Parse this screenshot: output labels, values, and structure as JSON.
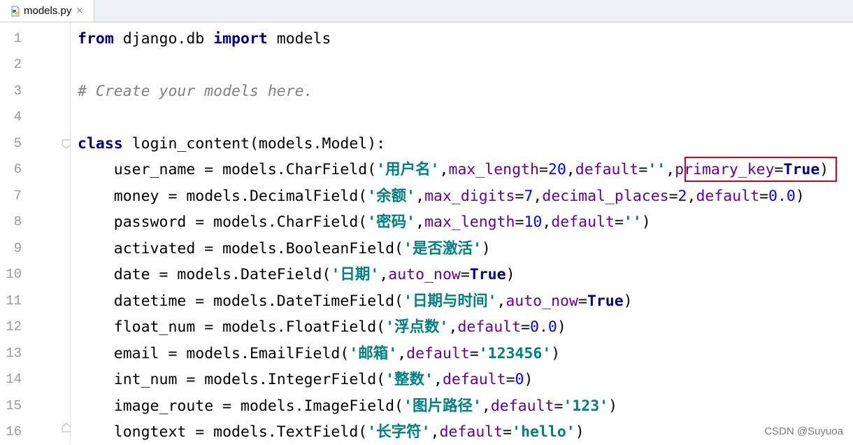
{
  "tab": {
    "filename": "models.py",
    "close_icon": "×"
  },
  "gutter": {
    "numbers": [
      "1",
      "2",
      "3",
      "4",
      "5",
      "6",
      "7",
      "8",
      "9",
      "10",
      "11",
      "12",
      "13",
      "14",
      "15",
      "16"
    ]
  },
  "code": {
    "l1": {
      "k1": "from",
      "t1": " django.db ",
      "k2": "import",
      "t2": " models"
    },
    "l3": {
      "c": "# Create your models here."
    },
    "l5": {
      "k": "class",
      "t": " login_content(models.Model):"
    },
    "l6": {
      "t1": "    user_name = models.CharField(",
      "s1": "'用户名'",
      "t2": ",",
      "a1": "max_length",
      "t3": "=",
      "n1": "20",
      "t4": ",",
      "a2": "default",
      "t5": "=",
      "s2": "''",
      "t6": ",",
      "a3": "primary_key",
      "t7": "=",
      "k1": "True",
      "t8": ")"
    },
    "l7": {
      "t1": "    money = models.DecimalField(",
      "s1": "'余额'",
      "t2": ",",
      "a1": "max_digits",
      "t3": "=",
      "n1": "7",
      "t4": ",",
      "a2": "decimal_places",
      "t5": "=",
      "n2": "2",
      "t6": ",",
      "a3": "default",
      "t7": "=",
      "n3": "0.0",
      "t8": ")"
    },
    "l8": {
      "t1": "    password = models.CharField(",
      "s1": "'密码'",
      "t2": ",",
      "a1": "max_length",
      "t3": "=",
      "n1": "10",
      "t4": ",",
      "a2": "default",
      "t5": "=",
      "s2": "''",
      "t6": ")"
    },
    "l9": {
      "t1": "    activated = models.BooleanField(",
      "s1": "'是否激活'",
      "t2": ")"
    },
    "l10": {
      "t1": "    date = models.DateField(",
      "s1": "'日期'",
      "t2": ",",
      "a1": "auto_now",
      "t3": "=",
      "k1": "True",
      "t4": ")"
    },
    "l11": {
      "t1": "    datetime = models.DateTimeField(",
      "s1": "'日期与时间'",
      "t2": ",",
      "a1": "auto_now",
      "t3": "=",
      "k1": "True",
      "t4": ")"
    },
    "l12": {
      "t1": "    float_num = models.FloatField(",
      "s1": "'浮点数'",
      "t2": ",",
      "a1": "default",
      "t3": "=",
      "n1": "0.0",
      "t4": ")"
    },
    "l13": {
      "t1": "    email = models.EmailField(",
      "s1": "'邮箱'",
      "t2": ",",
      "a1": "default",
      "t3": "=",
      "s2": "'123456'",
      "t4": ")"
    },
    "l14": {
      "t1": "    int_num = models.IntegerField(",
      "s1": "'整数'",
      "t2": ",",
      "a1": "default",
      "t3": "=",
      "n1": "0",
      "t4": ")"
    },
    "l15": {
      "t1": "    image_route = models.ImageField(",
      "s1": "'图片路径'",
      "t2": ",",
      "a1": "default",
      "t3": "=",
      "s2": "'123'",
      "t4": ")"
    },
    "l16": {
      "t1": "    longtext = models.TextField(",
      "s1": "'长字符'",
      "t2": ",",
      "a1": "default",
      "t3": "=",
      "s2": "'hello'",
      "t4": ")"
    }
  },
  "watermark": "CSDN @Suyuoa",
  "colors": {
    "keyword": "#000080",
    "string": "#008080",
    "number": "#0000ff",
    "kwarg": "#660099",
    "comment": "#808080",
    "highlight": "#d6001c"
  }
}
